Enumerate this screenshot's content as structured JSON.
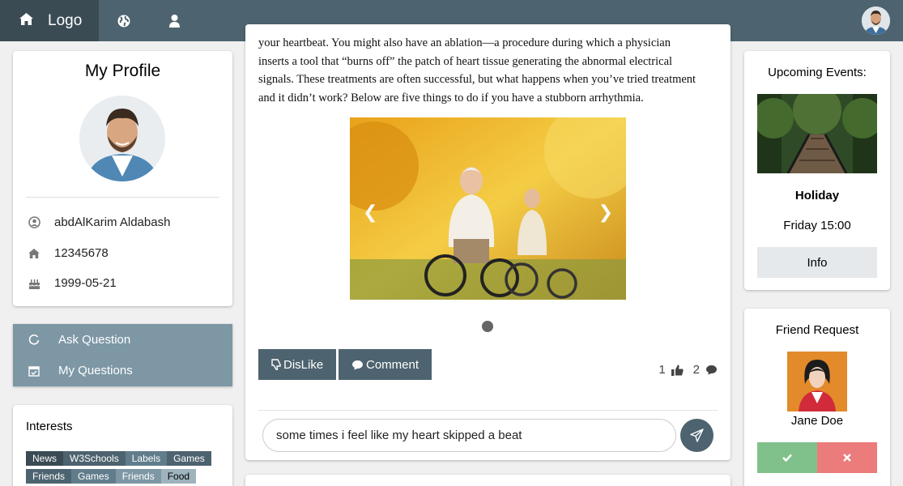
{
  "topbar": {
    "logo_label": "Logo"
  },
  "profile": {
    "title": "My Profile",
    "name": "abdAlKarim Aldabash",
    "phone": "12345678",
    "birthday": "1999-05-21"
  },
  "menu": {
    "ask": "Ask Question",
    "mine": "My Questions"
  },
  "interests": {
    "title": "Interests",
    "row1": [
      "News",
      "W3Schools",
      "Labels",
      "Games"
    ],
    "row2": [
      "Friends",
      "Games",
      "Friends",
      "Food"
    ]
  },
  "post": {
    "lines": [
      "your heartbeat. You might also have an ablation—a procedure during which a physician",
      "inserts a tool that “burns off” the patch of heart tissue generating the abnormal electrical",
      "signals. These treatments are often successful, but what happens when you’ve tried treatment",
      "and it didn’t work? Below are five things to do if you have a stubborn arrhythmia."
    ],
    "prev": "❮",
    "next": "❯",
    "dislike_label": "DisLike",
    "comment_label": "Comment",
    "likes": "1",
    "comments": "2",
    "comment_value": "some times i feel like my heart skipped a beat"
  },
  "events": {
    "title": "Upcoming Events:",
    "name": "Holiday",
    "time": "Friday 15:00",
    "info_label": "Info"
  },
  "friend": {
    "title": "Friend Request",
    "name": "Jane Doe"
  }
}
